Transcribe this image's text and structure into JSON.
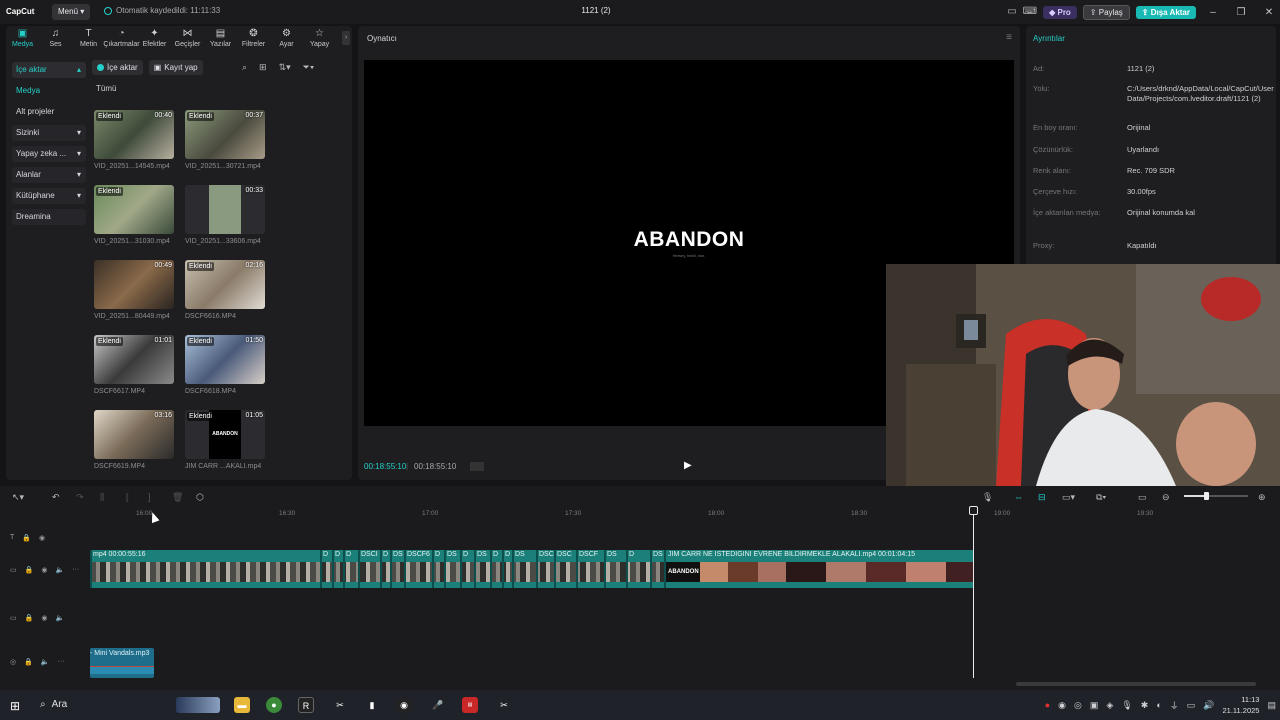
{
  "app": {
    "logo": "CapCut",
    "menu_label": "Menü",
    "autosave": "Otomatik kaydedildi: 11:11:33",
    "project_title": "1121 (2)",
    "pro_label": "Pro",
    "share_label": "Paylaş",
    "export_label": "Dışa Aktar"
  },
  "toolbar": {
    "items": [
      {
        "label": "Medya",
        "icon": "media-icon"
      },
      {
        "label": "Ses",
        "icon": "audio-icon"
      },
      {
        "label": "Metin",
        "icon": "text-icon"
      },
      {
        "label": "Çıkartmalar",
        "icon": "sticker-icon"
      },
      {
        "label": "Efektler",
        "icon": "effects-icon"
      },
      {
        "label": "Geçişler",
        "icon": "transitions-icon"
      },
      {
        "label": "Yazılar",
        "icon": "captions-icon"
      },
      {
        "label": "Filtreler",
        "icon": "filters-icon"
      },
      {
        "label": "Ayar",
        "icon": "adjust-icon"
      },
      {
        "label": "Yapay",
        "icon": "ai-icon"
      }
    ]
  },
  "sidebar": {
    "items": [
      {
        "label": "İçe aktar"
      },
      {
        "label": "Medya"
      },
      {
        "label": "Alt projeler"
      },
      {
        "label": "Sizinki"
      },
      {
        "label": "Yapay zeka ..."
      },
      {
        "label": "Alanlar"
      },
      {
        "label": "Kütüphane"
      },
      {
        "label": "Dreamina"
      }
    ]
  },
  "media": {
    "import_label": "İçe aktar",
    "record_label": "Kayıt yap",
    "filter_label": "Tümü",
    "clips": [
      {
        "name": "VID_20251...14545.mp4",
        "tag": "Eklendi",
        "duration": "00:40"
      },
      {
        "name": "VID_20251...30721.mp4",
        "tag": "Eklendi",
        "duration": "00:37"
      },
      {
        "name": "VID_20251...31030.mp4",
        "tag": "Eklendi",
        "duration": ""
      },
      {
        "name": "VID_20251...33606.mp4",
        "tag": "",
        "duration": "00:33"
      },
      {
        "name": "VID_20251...80449.mp4",
        "tag": "",
        "duration": "00:49"
      },
      {
        "name": "DSCF6616.MP4",
        "tag": "Eklendi",
        "duration": "02:16"
      },
      {
        "name": "DSCF6617.MP4",
        "tag": "Eklendi",
        "duration": "01:01"
      },
      {
        "name": "DSCF6618.MP4",
        "tag": "Eklendi",
        "duration": "01:50"
      },
      {
        "name": "DSCF6619.MP4",
        "tag": "",
        "duration": "03:16"
      },
      {
        "name": "JİM CARR ...AKALI.mp4",
        "tag": "Eklendi",
        "duration": "01:05",
        "thumb_text": "ABANDON"
      }
    ]
  },
  "player": {
    "title": "Oynatıcı",
    "screen_text": "ABANDON",
    "screen_subtext": "Hersey, farkli, olur.",
    "current_time": "00:18:55:10",
    "total_time": "00:18:55:10"
  },
  "details": {
    "title": "Ayrıntılar",
    "rows": [
      {
        "key": "Ad:",
        "value": "1121 (2)"
      },
      {
        "key": "Yolu:",
        "value": "C:/Users/drknd/AppData/Local/CapCut/User Data/Projects/com.lveditor.draft/1121 (2)"
      },
      {
        "key": "En boy oranı:",
        "value": "Orijinal"
      },
      {
        "key": "Çözünürlük:",
        "value": "Uyarlandı"
      },
      {
        "key": "Renk alanı:",
        "value": "Rec. 709 SDR"
      },
      {
        "key": "Çerçeve hızı:",
        "value": "30.00fps"
      },
      {
        "key": "İçe aktarılan medya:",
        "value": "Orijinal konumda kal"
      },
      {
        "key": "Proxy:",
        "value": "Kapatıldı"
      }
    ]
  },
  "timeline": {
    "ruler": [
      "16:00",
      "16:30",
      "17:00",
      "17:30",
      "18:00",
      "18:30",
      "19:00",
      "19:30"
    ],
    "video_clips": [
      {
        "label": "mp4  00:00:55:16"
      },
      {
        "label": "D"
      },
      {
        "label": "D"
      },
      {
        "label": "D"
      },
      {
        "label": "DSCI"
      },
      {
        "label": "D"
      },
      {
        "label": "DS"
      },
      {
        "label": "DSCF6"
      },
      {
        "label": "D"
      },
      {
        "label": "DS"
      },
      {
        "label": "D"
      },
      {
        "label": "DS"
      },
      {
        "label": "D"
      },
      {
        "label": "D"
      },
      {
        "label": "DS"
      },
      {
        "label": "DSC"
      },
      {
        "label": "DSC"
      },
      {
        "label": "DSCF"
      },
      {
        "label": "DSCI"
      },
      {
        "label": "D"
      },
      {
        "label": "DSCF"
      },
      {
        "label": "D"
      },
      {
        "label": "JİM CARR NE İSTEDİĞİNİ EVRENE BİLDİRMEKLE ALAKALI.mp4  00:01:04:15"
      }
    ],
    "abandon_overlay": "ABANDON",
    "audio_clip": "- Mini Vandals.mp3"
  },
  "taskbar": {
    "search_label": "Ara",
    "time": "11:13",
    "date": "21.11.2025"
  },
  "colors": {
    "accent": "#25d0c8",
    "export": "#19b9b3",
    "video_track": "#1b7f7a",
    "audio_track": "#1e6d8a"
  }
}
